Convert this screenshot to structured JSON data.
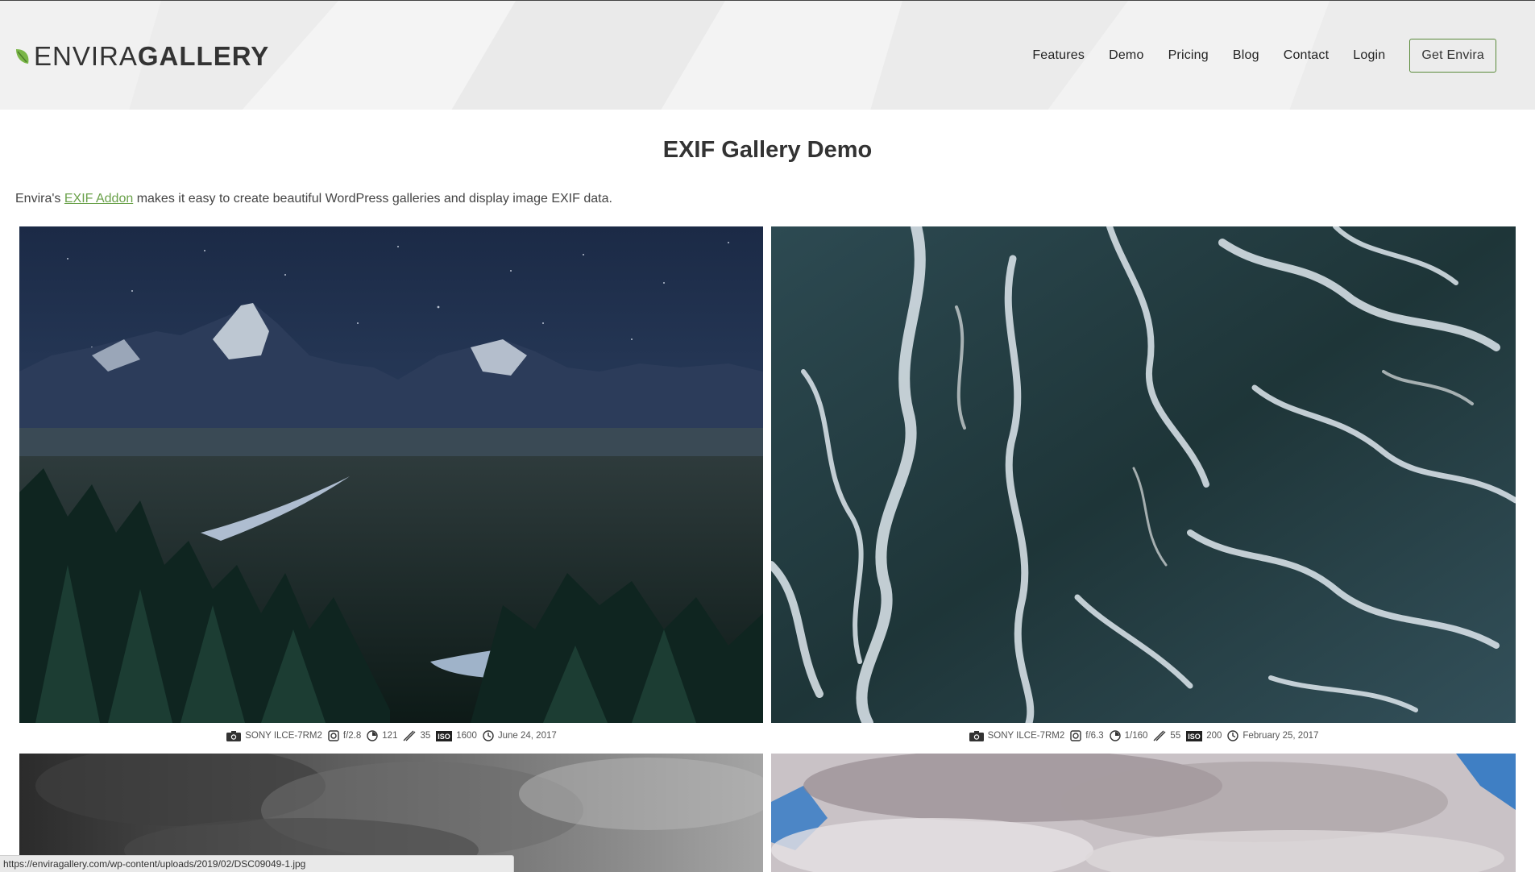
{
  "brand": {
    "logo_part1": "ENVIRA",
    "logo_part2": "GALLERY",
    "accent_color": "#6aa14a"
  },
  "nav": {
    "items": [
      "Features",
      "Demo",
      "Pricing",
      "Blog",
      "Contact",
      "Login"
    ],
    "cta_label": "Get Envira"
  },
  "page": {
    "title": "EXIF Gallery Demo",
    "intro_prefix": "Envira's ",
    "intro_link": "EXIF Addon",
    "intro_suffix": " makes it easy to create beautiful WordPress galleries and display image EXIF data."
  },
  "gallery": {
    "images": [
      {
        "subject": "mountain-river-night",
        "camera": "SONY ILCE-7RM2",
        "aperture": "f/2.8",
        "shutter": "121",
        "focal": "35",
        "iso": "1600",
        "date": "June 24, 2017"
      },
      {
        "subject": "ocean-waves-aerial",
        "camera": "SONY ILCE-7RM2",
        "aperture": "f/6.3",
        "shutter": "1/160",
        "focal": "55",
        "iso": "200",
        "date": "February 25, 2017"
      },
      {
        "subject": "storm-clouds"
      },
      {
        "subject": "cloudy-sky"
      }
    ],
    "iso_badge": "ISO"
  },
  "statusbar": {
    "url": "https://enviragallery.com/wp-content/uploads/2019/02/DSC09049-1.jpg"
  },
  "icons": {
    "camera": "camera-icon",
    "aperture": "aperture-icon",
    "shutter": "shutter-icon",
    "focal": "focal-length-icon",
    "date": "clock-icon"
  }
}
